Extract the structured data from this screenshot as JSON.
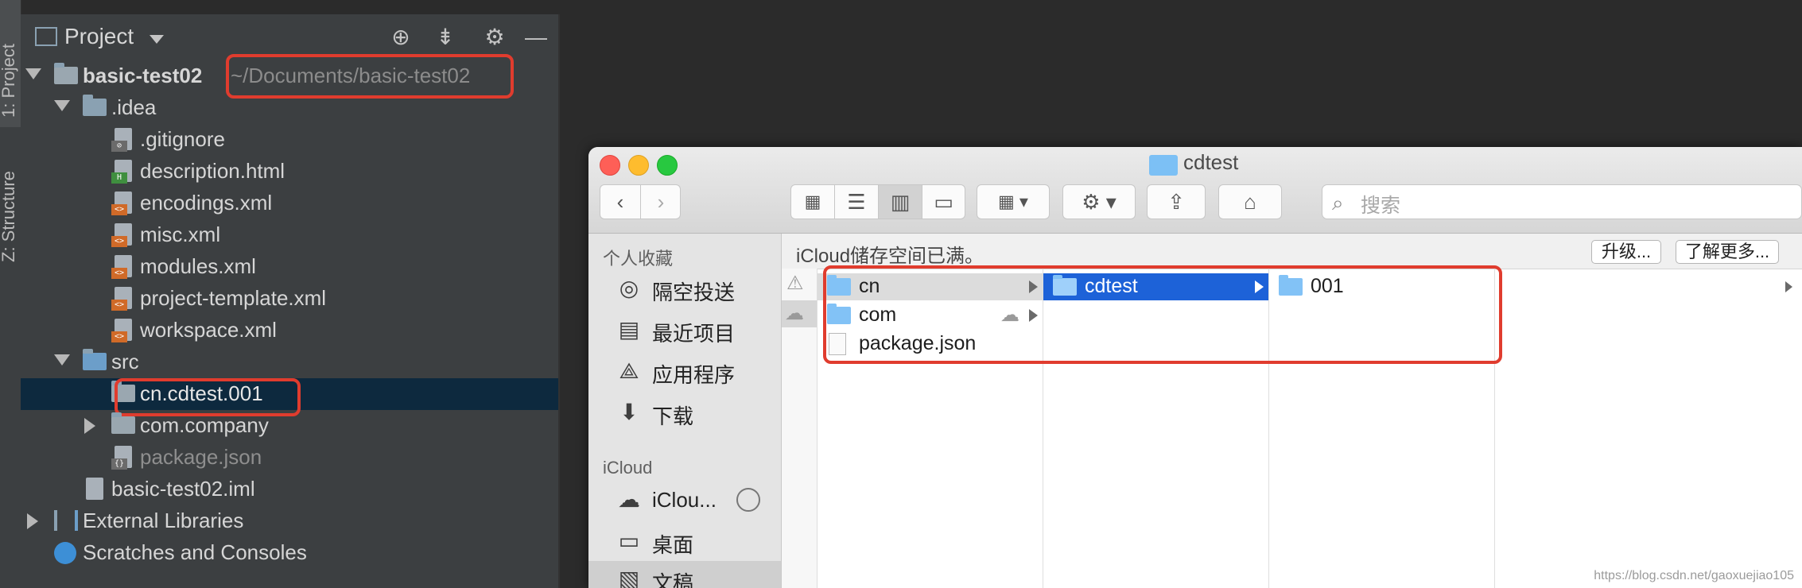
{
  "ide": {
    "stripe_tabs": [
      "1: Project",
      "Z: Structure"
    ],
    "panel_title": "Project",
    "header_icons": [
      "locate-icon",
      "collapse-icon",
      "gear-icon",
      "minimize-icon"
    ],
    "tree": [
      {
        "label": "basic-test02",
        "suffix": "~/Documents/basic-test02",
        "type": "module",
        "depth": 0,
        "arrow": "down"
      },
      {
        "label": ".idea",
        "type": "folder",
        "depth": 1,
        "arrow": "down"
      },
      {
        "label": ".gitignore",
        "type": "file",
        "depth": 2,
        "tag": "⊘"
      },
      {
        "label": "description.html",
        "type": "file",
        "depth": 2,
        "tag": "H"
      },
      {
        "label": "encodings.xml",
        "type": "file",
        "depth": 2,
        "tag": "<>"
      },
      {
        "label": "misc.xml",
        "type": "file",
        "depth": 2,
        "tag": "<>"
      },
      {
        "label": "modules.xml",
        "type": "file",
        "depth": 2,
        "tag": "<>"
      },
      {
        "label": "project-template.xml",
        "type": "file",
        "depth": 2,
        "tag": "<>"
      },
      {
        "label": "workspace.xml",
        "type": "file",
        "depth": 2,
        "tag": "<>"
      },
      {
        "label": "src",
        "type": "src-folder",
        "depth": 1,
        "arrow": "down"
      },
      {
        "label": "cn.cdtest.001",
        "type": "package",
        "depth": 2,
        "selected": true
      },
      {
        "label": "com.company",
        "type": "package",
        "depth": 2,
        "arrow": "right"
      },
      {
        "label": "package.json",
        "type": "file",
        "depth": 2,
        "tag": "{}",
        "dim": true
      },
      {
        "label": "basic-test02.iml",
        "type": "file",
        "depth": 1,
        "tag": ""
      },
      {
        "label": "External Libraries",
        "type": "libraries",
        "depth": 0,
        "arrow": "right"
      },
      {
        "label": "Scratches and Consoles",
        "type": "scratches",
        "depth": 0
      }
    ]
  },
  "finder": {
    "title": "cdtest",
    "search_placeholder": "搜索",
    "banner": {
      "message": "iCloud储存空间已满。",
      "upgrade": "升级...",
      "learn_more": "了解更多..."
    },
    "sidebar": {
      "favorites_heading": "个人收藏",
      "favorites": [
        {
          "label": "隔空投送",
          "icon": "airdrop-icon"
        },
        {
          "label": "最近项目",
          "icon": "recents-icon"
        },
        {
          "label": "应用程序",
          "icon": "applications-icon"
        },
        {
          "label": "下载",
          "icon": "downloads-icon"
        }
      ],
      "icloud_heading": "iCloud",
      "icloud": [
        {
          "label": "iClou...",
          "icon": "icloud-drive-icon"
        },
        {
          "label": "桌面",
          "icon": "desktop-icon"
        },
        {
          "label": "文稿",
          "icon": "documents-icon"
        }
      ]
    },
    "columns": [
      [
        {
          "label": "cn",
          "type": "folder",
          "state": "highlighted"
        },
        {
          "label": "com",
          "type": "folder",
          "cloud": true
        },
        {
          "label": "package.json",
          "type": "file"
        }
      ],
      [
        {
          "label": "cdtest",
          "type": "folder",
          "state": "selected"
        }
      ],
      [
        {
          "label": "001",
          "type": "folder"
        }
      ]
    ]
  },
  "watermark": "https://blog.csdn.net/gaoxuejiao105",
  "colors": {
    "annotation_red": "#e03c2e",
    "selection_blue": "#1d62d8",
    "ide_selection": "#0d293e"
  }
}
